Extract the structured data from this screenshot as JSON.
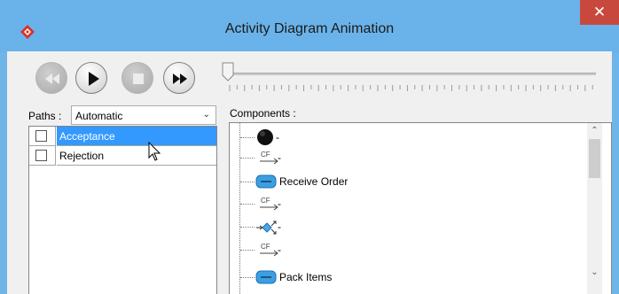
{
  "window": {
    "title": "Activity Diagram Animation",
    "close_glyph": "✕",
    "accent": "#6ab3ea"
  },
  "toolbar": {
    "buttons": [
      {
        "name": "rewind",
        "icon": "rewind-icon",
        "enabled": false
      },
      {
        "name": "play",
        "icon": "play-icon",
        "enabled": true
      },
      {
        "name": "stop",
        "icon": "stop-icon",
        "enabled": false
      },
      {
        "name": "fast-forward",
        "icon": "fast-forward-icon",
        "enabled": true
      }
    ],
    "slider_position": 0
  },
  "paths": {
    "label": "Paths :",
    "selected": "Automatic",
    "items": [
      {
        "name": "Acceptance",
        "checked": false,
        "selected": true
      },
      {
        "name": "Rejection",
        "checked": false,
        "selected": false
      }
    ]
  },
  "components": {
    "label": "Components :",
    "items": [
      {
        "icon": "initial-node-icon",
        "label": "-"
      },
      {
        "icon": "control-flow-icon",
        "label": "-",
        "cf": "CF"
      },
      {
        "icon": "action-icon",
        "label": "Receive Order"
      },
      {
        "icon": "control-flow-icon",
        "label": "-",
        "cf": "CF"
      },
      {
        "icon": "fork-node-icon",
        "label": "-"
      },
      {
        "icon": "control-flow-icon",
        "label": "-",
        "cf": "CF"
      },
      {
        "icon": "action-icon",
        "label": "Pack Items"
      }
    ]
  }
}
